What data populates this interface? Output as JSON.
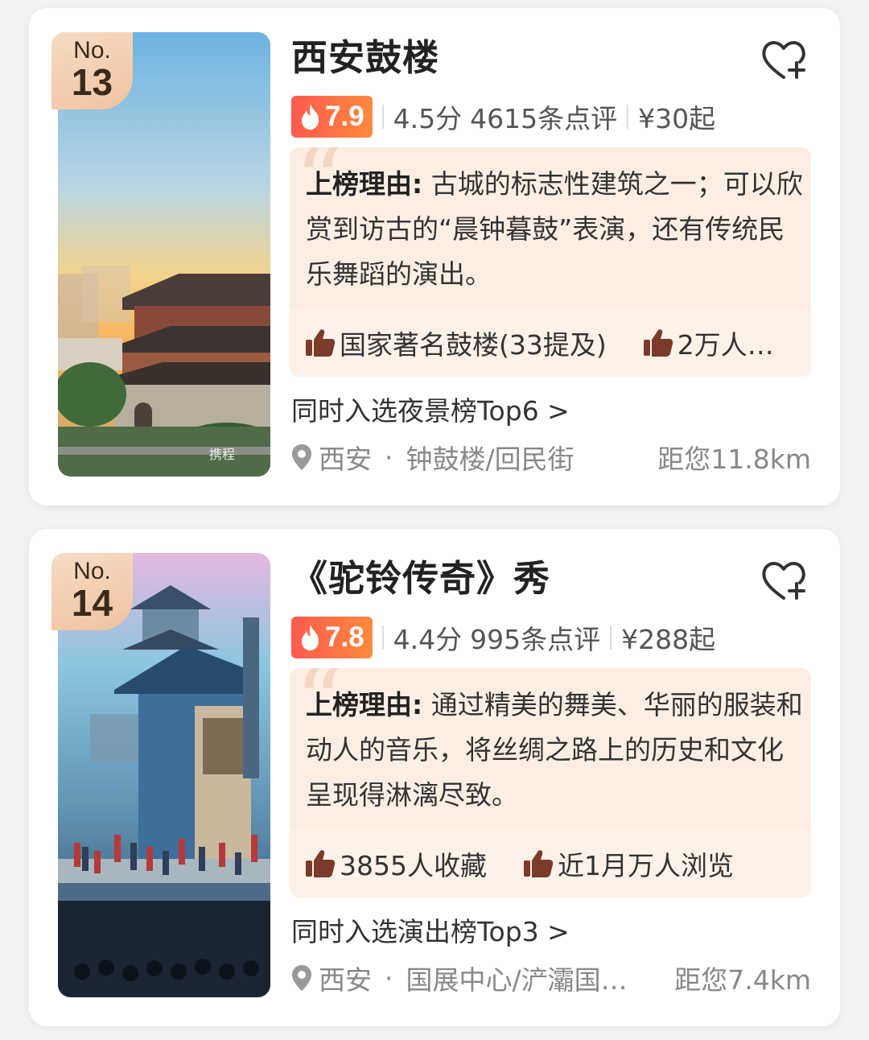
{
  "cards": [
    {
      "rank_prefix": "No.",
      "rank": "13",
      "title": "西安鼓楼",
      "heat": "7.9",
      "score": "4.5分",
      "reviews": "4615条点评",
      "price": "¥30起",
      "reason_label": "上榜理由:",
      "reason_text": " 古城的标志性建筑之一；可以欣赏到访古的“晨钟暮鼓”表演，还有传统民乐舞蹈的演出。",
      "tags": [
        "国家著名鼓楼(33提及)",
        "2万人…"
      ],
      "also_selected": "同时入选夜景榜Top6 >",
      "city": "西安",
      "area": "钟鼓楼/回民街",
      "distance": "距您11.8km",
      "image_watermark": "携程"
    },
    {
      "rank_prefix": "No.",
      "rank": "14",
      "title": "《驼铃传奇》秀",
      "heat": "7.8",
      "score": "4.4分",
      "reviews": "995条点评",
      "price": "¥288起",
      "reason_label": "上榜理由:",
      "reason_text": " 通过精美的舞美、华丽的服装和动人的音乐，将丝绸之路上的历史和文化呈现得淋漓尽致。",
      "tags": [
        "3855人收藏",
        "近1月万人浏览"
      ],
      "also_selected": "同时入选演出榜Top3 >",
      "city": "西安",
      "area": "国展中心/浐灞国…",
      "distance": "距您7.4km"
    }
  ],
  "colors": {
    "heat_gradient_start": "#ff5a4f",
    "heat_gradient_end": "#ff8a3d",
    "reason_bg": "#fdeee3",
    "rank_badge": "#f0c29f"
  },
  "icons": [
    "heart-plus-icon",
    "flame-icon",
    "thumbs-up-icon",
    "location-pin-icon"
  ]
}
